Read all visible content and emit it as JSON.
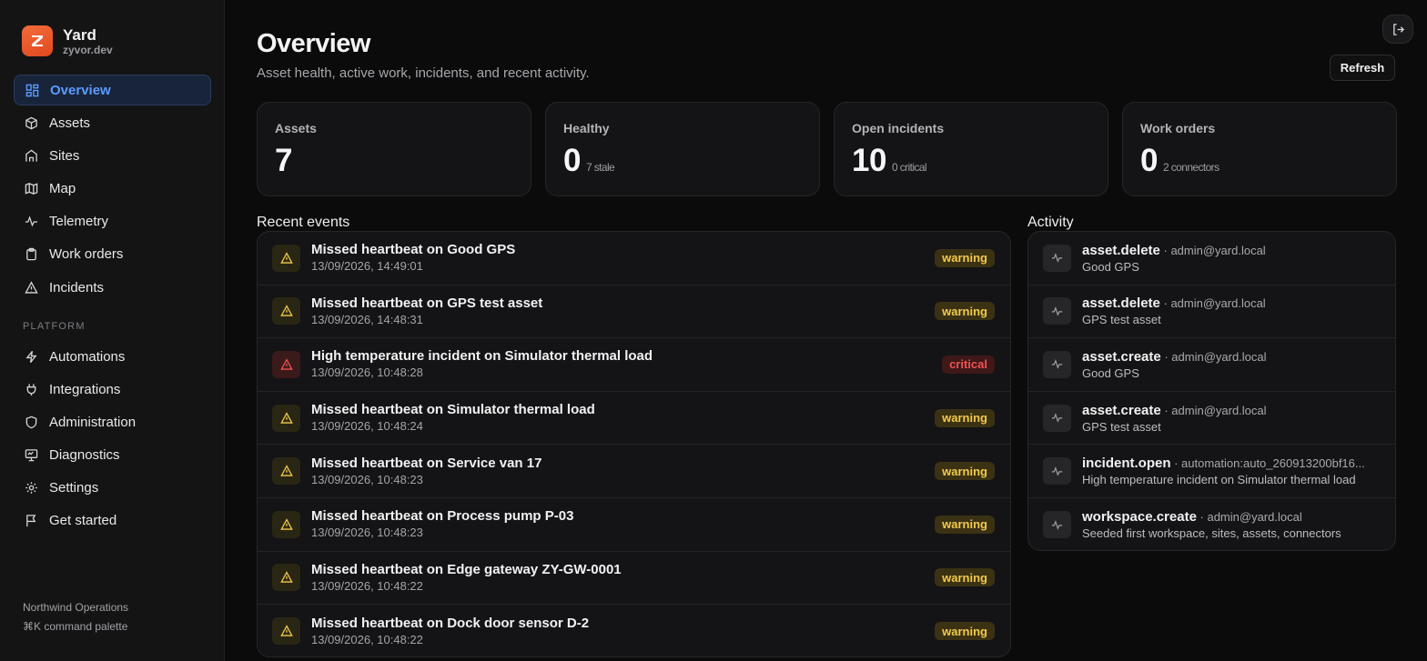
{
  "brand": {
    "name": "Yard",
    "domain": "zyvor.dev",
    "logo_letter": "Z",
    "logo_color": "#f26b3a"
  },
  "nav": {
    "main": [
      {
        "label": "Overview",
        "icon": "dashboard-icon",
        "active": true
      },
      {
        "label": "Assets",
        "icon": "box-icon"
      },
      {
        "label": "Sites",
        "icon": "building-icon"
      },
      {
        "label": "Map",
        "icon": "map-icon"
      },
      {
        "label": "Telemetry",
        "icon": "pulse-icon"
      },
      {
        "label": "Work orders",
        "icon": "clipboard-icon"
      },
      {
        "label": "Incidents",
        "icon": "alert-triangle-icon"
      }
    ],
    "platform_label": "PLATFORM",
    "platform": [
      {
        "label": "Automations",
        "icon": "lightning-icon"
      },
      {
        "label": "Integrations",
        "icon": "plug-icon"
      },
      {
        "label": "Administration",
        "icon": "shield-icon"
      },
      {
        "label": "Diagnostics",
        "icon": "monitor-icon"
      },
      {
        "label": "Settings",
        "icon": "gear-icon"
      },
      {
        "label": "Get started",
        "icon": "flag-icon"
      }
    ]
  },
  "footer": {
    "org": "Northwind Operations",
    "shortcut": "⌘K command palette"
  },
  "header": {
    "title": "Overview",
    "subtitle": "Asset health, active work, incidents, and recent activity.",
    "refresh_label": "Refresh"
  },
  "stats": [
    {
      "label": "Assets",
      "value": "7",
      "note": ""
    },
    {
      "label": "Healthy",
      "value": "0",
      "note": "7 stale"
    },
    {
      "label": "Open incidents",
      "value": "10",
      "note": "0 critical"
    },
    {
      "label": "Work orders",
      "value": "0",
      "note": "2 connectors"
    }
  ],
  "events_title": "Recent events",
  "events": [
    {
      "title": "Missed heartbeat on Good GPS",
      "time": "13/09/2026, 14:49:01",
      "severity": "warning"
    },
    {
      "title": "Missed heartbeat on GPS test asset",
      "time": "13/09/2026, 14:48:31",
      "severity": "warning"
    },
    {
      "title": "High temperature incident on Simulator thermal load",
      "time": "13/09/2026, 10:48:28",
      "severity": "critical"
    },
    {
      "title": "Missed heartbeat on Simulator thermal load",
      "time": "13/09/2026, 10:48:24",
      "severity": "warning"
    },
    {
      "title": "Missed heartbeat on Service van 17",
      "time": "13/09/2026, 10:48:23",
      "severity": "warning"
    },
    {
      "title": "Missed heartbeat on Process pump P-03",
      "time": "13/09/2026, 10:48:23",
      "severity": "warning"
    },
    {
      "title": "Missed heartbeat on Edge gateway ZY-GW-0001",
      "time": "13/09/2026, 10:48:22",
      "severity": "warning"
    },
    {
      "title": "Missed heartbeat on Dock door sensor D-2",
      "time": "13/09/2026, 10:48:22",
      "severity": "warning"
    }
  ],
  "activity_title": "Activity",
  "activity": [
    {
      "action": "asset.delete",
      "actor": " · admin@yard.local",
      "detail": "Good GPS"
    },
    {
      "action": "asset.delete",
      "actor": " · admin@yard.local",
      "detail": "GPS test asset"
    },
    {
      "action": "asset.create",
      "actor": " · admin@yard.local",
      "detail": "Good GPS"
    },
    {
      "action": "asset.create",
      "actor": " · admin@yard.local",
      "detail": "GPS test asset"
    },
    {
      "action": "incident.open",
      "actor": " · automation:auto_260913200bf16...",
      "detail": "High temperature incident on Simulator thermal load"
    },
    {
      "action": "workspace.create",
      "actor": " · admin@yard.local",
      "detail": "Seeded first workspace, sites, assets, connectors"
    }
  ],
  "colors": {
    "accent": "#5b9bff",
    "warning": "#f2c94c",
    "critical": "#f05252"
  }
}
